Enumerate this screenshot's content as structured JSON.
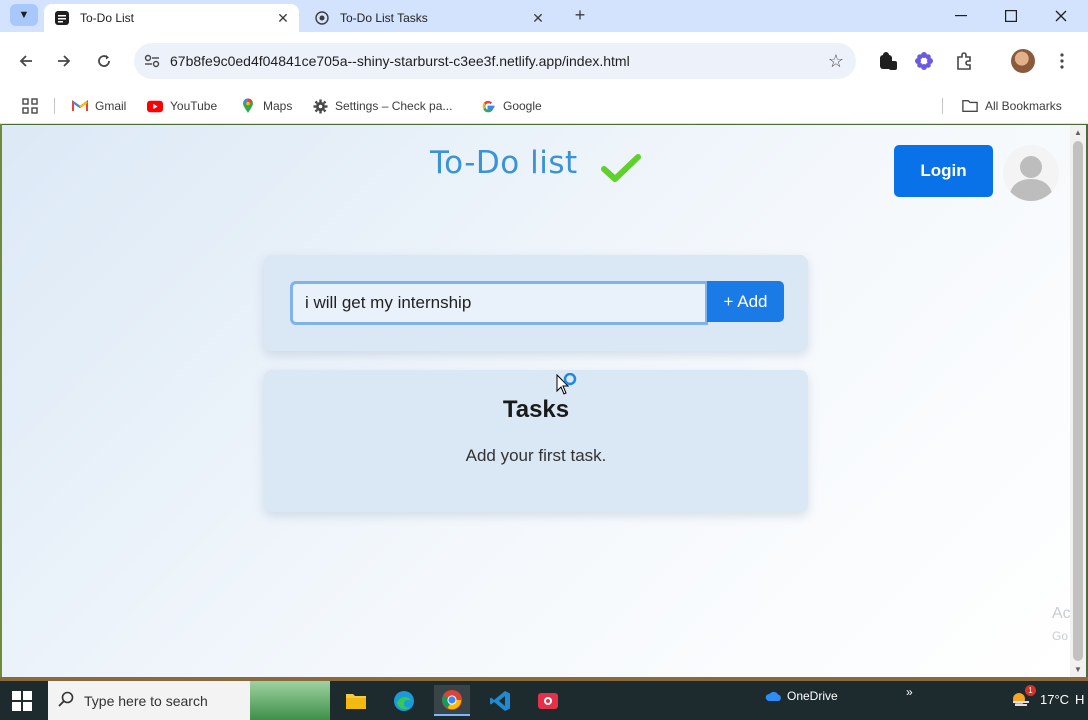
{
  "browser": {
    "tabs": [
      {
        "title": "To-Do List",
        "active": true
      },
      {
        "title": "To-Do List Tasks",
        "active": false
      }
    ],
    "new_tab_label": "+",
    "url": "67b8fe9c0ed4f04841ce705a--shiny-starburst-c3ee3f.netlify.app/index.html",
    "bookmarks": [
      {
        "label": "Gmail",
        "icon": "gmail-icon"
      },
      {
        "label": "YouTube",
        "icon": "youtube-icon"
      },
      {
        "label": "Maps",
        "icon": "maps-icon"
      },
      {
        "label": "Settings – Check pa...",
        "icon": "gear-icon"
      },
      {
        "label": "Google",
        "icon": "google-icon"
      }
    ],
    "all_bookmarks_label": "All Bookmarks"
  },
  "page": {
    "title": "To-Do list",
    "login_label": "Login",
    "task_input_value": "i will get my internship",
    "add_label": "+ Add",
    "tasks_heading": "Tasks",
    "tasks_empty": "Add your first task.",
    "watermark_line1": "Ac",
    "watermark_line2": "Go",
    "colors": {
      "title": "#3a93d4",
      "login": "#0a72e8",
      "add": "#1a7be6",
      "card": "#dae7f4",
      "check": "#5ed12a"
    }
  },
  "taskbar": {
    "search_placeholder": "Type here to search",
    "onedrive_label": "OneDrive",
    "chevron": "»",
    "temperature": "17°C",
    "weather_suffix": "H",
    "notification_count": "1"
  }
}
